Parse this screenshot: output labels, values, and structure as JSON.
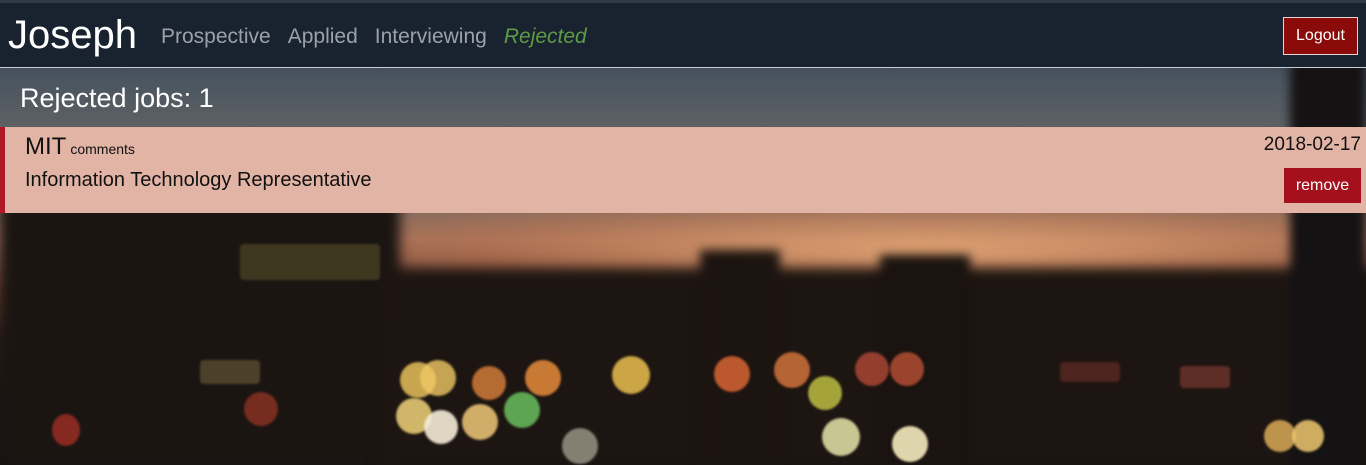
{
  "navbar": {
    "brand": "Joseph",
    "links": [
      {
        "label": "Prospective",
        "active": false
      },
      {
        "label": "Applied",
        "active": false
      },
      {
        "label": "Interviewing",
        "active": false
      },
      {
        "label": "Rejected",
        "active": true
      }
    ],
    "logout_label": "Logout"
  },
  "main": {
    "count_heading": "Rejected jobs: 1",
    "jobs": [
      {
        "company": "MIT",
        "comments_label": "comments",
        "title": "Information Technology Representative",
        "date": "2018-02-17",
        "remove_label": "remove"
      }
    ]
  },
  "colors": {
    "navbar_bg": "#19232f",
    "active_link": "#5e9b46",
    "logout_bg": "#8b0a0a",
    "card_bg": "#e2b4a5",
    "card_accent": "#b01822",
    "remove_bg": "#a5101d"
  }
}
